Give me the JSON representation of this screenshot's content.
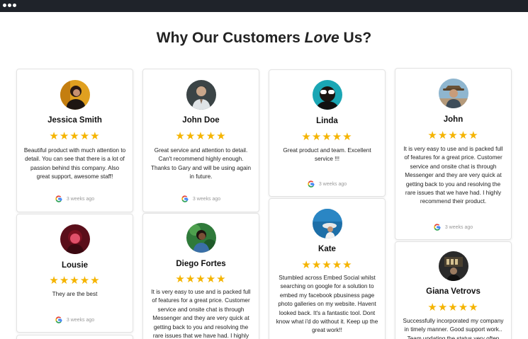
{
  "window": {
    "dots": [
      "",
      "",
      ""
    ]
  },
  "heading": {
    "prefix": "Why Our Customers ",
    "emphasis": "Love",
    "suffix": " Us?"
  },
  "colors": {
    "star": "#f5b400",
    "topbar": "#1f232a"
  },
  "reviews": [
    {
      "name": "Jessica Smith",
      "rating": 5,
      "stars": "★★★★★",
      "text": "Beautiful product with much attention to detail. You can see that there is a lot of passion behind this company. Also great support, awesome staff!",
      "time": "3 weeks ago",
      "source_icon": "google-icon"
    },
    {
      "name": "John Doe",
      "rating": 5,
      "stars": "★★★★★",
      "text": "Great service and attention to detail. Can't recommend highly enough. Thanks to Gary and will be using again in future.",
      "time": "3 weeks ago",
      "source_icon": "google-icon"
    },
    {
      "name": "Linda",
      "rating": 5,
      "stars": "★★★★★",
      "text": "Great product and team. Excellent service !!!",
      "time": "3 weeks ago",
      "source_icon": "google-icon"
    },
    {
      "name": "John",
      "rating": 5,
      "stars": "★★★★★",
      "text": "It is very easy to use and is packed full of features for a great price. Customer service and onsite chat is through Messenger and they are very quick at getting back to you and resolving the rare issues that we have had. I highly recommend their product.",
      "time": "3 weeks ago",
      "source_icon": "google-icon"
    },
    {
      "name": "Lousie",
      "rating": 5,
      "stars": "★★★★★",
      "text": "They are the best",
      "time": "3 weeks ago",
      "source_icon": "google-icon"
    },
    {
      "name": "Diego Fortes",
      "rating": 5,
      "stars": "★★★★★",
      "text": "It is very easy to use and is packed full of features for a great price. Customer service and onsite chat is through Messenger and they are very quick at getting back to you and resolving the rare issues that we have had. I highly",
      "time": "",
      "source_icon": "google-icon"
    },
    {
      "name": "Kate",
      "rating": 5,
      "stars": "★★★★★",
      "text": "Stumbled across Embed Social whilst searching on google for a solution to embed my facebook pbusiness page photo galleries on my website. Havent looked back. It's a fantastic tool. Dont know what i'd do without it. Keep up the great work!!",
      "time": "",
      "source_icon": "google-icon"
    },
    {
      "name": "Giana Vetrovs",
      "rating": 5,
      "stars": "★★★★★",
      "text": "Successfully incorporated my company in timely manner. Good support work.. Team updating the status very often",
      "time": "",
      "source_icon": "google-icon"
    }
  ]
}
